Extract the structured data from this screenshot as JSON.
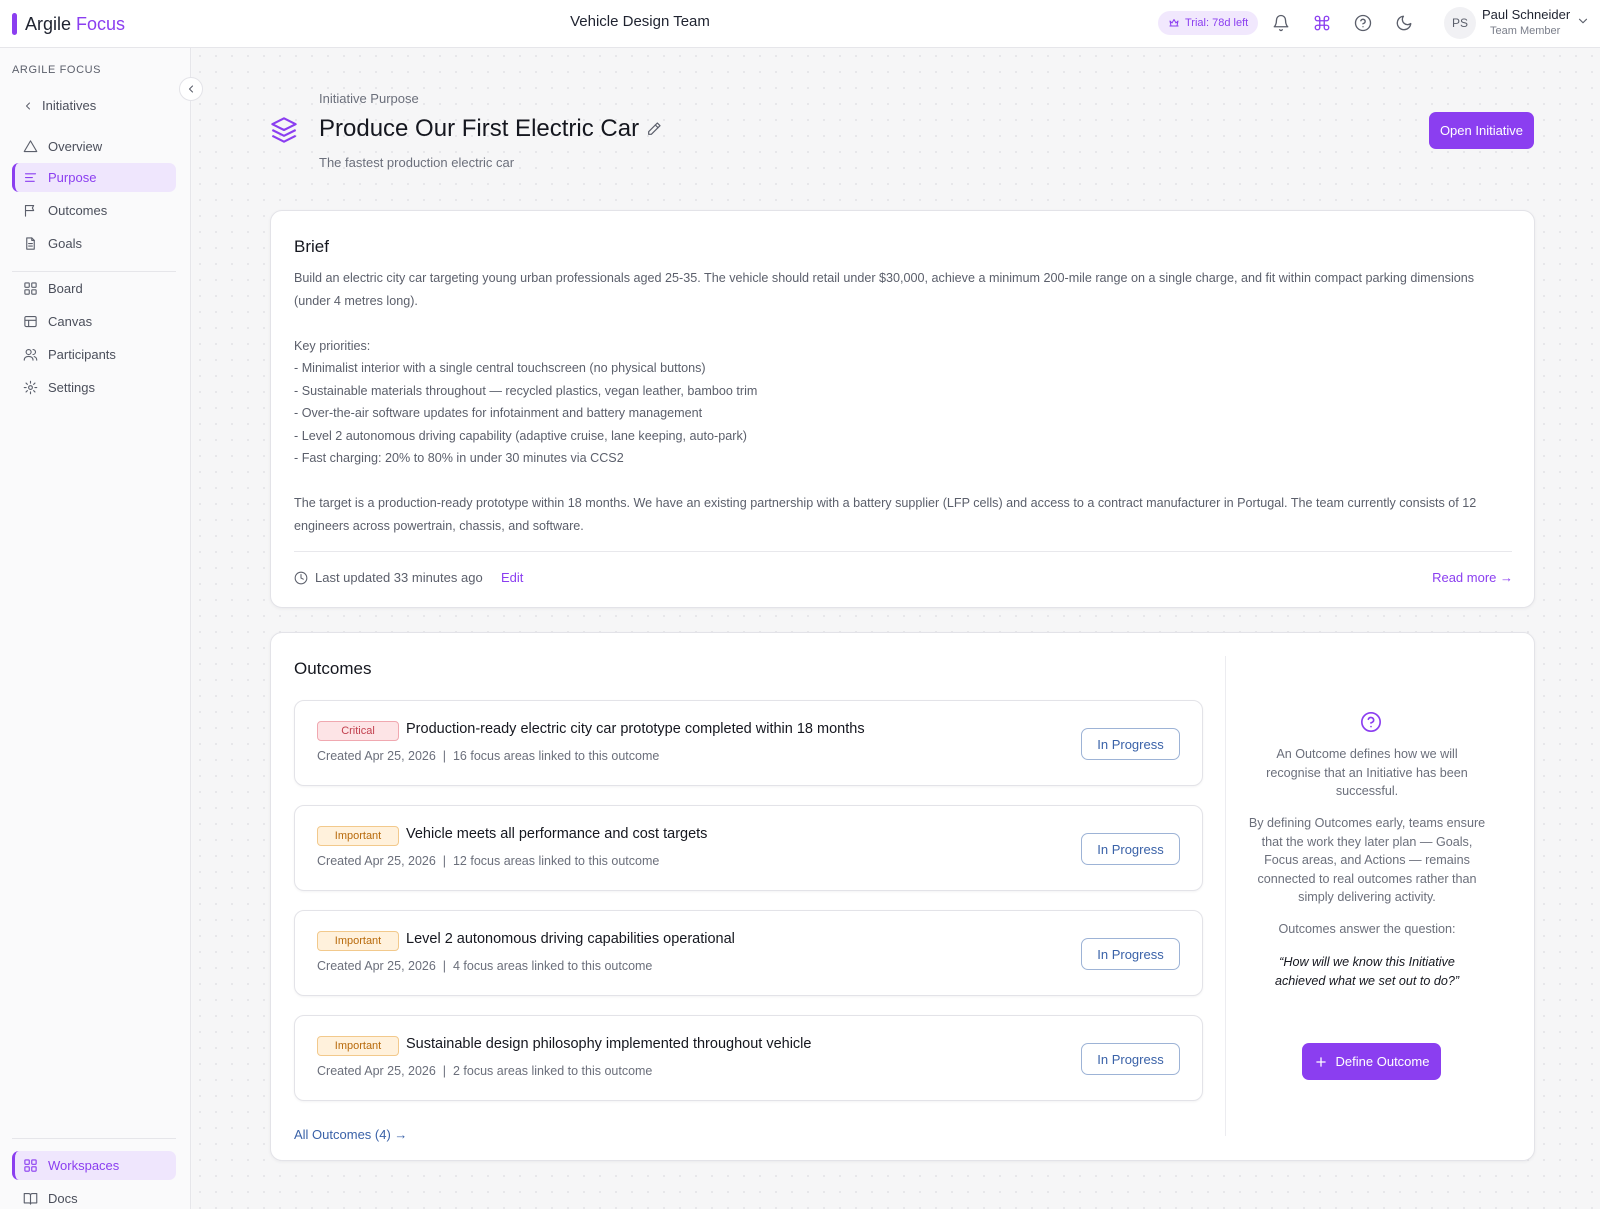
{
  "app": {
    "brand_name": "Argile",
    "brand_accent": "Focus",
    "team_title": "Vehicle Design Team",
    "trial_badge": "Trial: 78d left",
    "accent_color": "#8b3ef0"
  },
  "user": {
    "initials": "PS",
    "name": "Paul Schneider",
    "role": "Team Member"
  },
  "sidebar": {
    "heading": "ARGILE FOCUS",
    "back_label": "Initiatives",
    "items": [
      {
        "label": "Overview",
        "icon": "triangle-icon"
      },
      {
        "label": "Purpose",
        "icon": "align-left-icon",
        "active": true
      },
      {
        "label": "Outcomes",
        "icon": "flag-icon"
      },
      {
        "label": "Goals",
        "icon": "document-icon"
      },
      {
        "label": "Board",
        "icon": "grid-icon"
      },
      {
        "label": "Canvas",
        "icon": "layout-icon"
      },
      {
        "label": "Participants",
        "icon": "users-icon"
      },
      {
        "label": "Settings",
        "icon": "gear-icon"
      }
    ],
    "bottom": [
      {
        "label": "Workspaces",
        "icon": "grid-icon",
        "active": true
      },
      {
        "label": "Docs",
        "icon": "book-icon"
      }
    ]
  },
  "page": {
    "eyebrow": "Initiative Purpose",
    "title": "Produce Our First Electric Car",
    "subtitle": "The fastest production electric car",
    "open_button": "Open Initiative"
  },
  "brief": {
    "title": "Brief",
    "paragraph_1": "Build an electric city car targeting young urban professionals aged 25-35. The vehicle should retail under $30,000, achieve a minimum 200-mile range on a single charge, and fit within compact parking dimensions (under 4 metres long).",
    "priorities_heading": "Key priorities:",
    "priorities": [
      "- Minimalist interior with a single central touchscreen (no physical buttons)",
      "- Sustainable materials throughout — recycled plastics, vegan leather, bamboo trim",
      "- Over-the-air software updates for infotainment and battery management",
      "- Level 2 autonomous driving capability (adaptive cruise, lane keeping, auto-park)",
      "- Fast charging: 20% to 80% in under 30 minutes via CCS2"
    ],
    "paragraph_2": "The target is a production-ready prototype within 18 months. We have an existing partnership with a battery supplier (LFP cells) and access to a contract manufacturer in Portugal. The team currently consists of 12 engineers across powertrain, chassis, and software.",
    "last_updated": "Last updated 33 minutes ago",
    "edit_label": "Edit",
    "read_more": "Read more →"
  },
  "outcomes": {
    "title": "Outcomes",
    "items": [
      {
        "priority": "Critical",
        "title": "Production-ready electric city car prototype completed within 18 months",
        "meta": "Created Apr 25, 2026  |  16 focus areas linked to this outcome",
        "status": "In Progress"
      },
      {
        "priority": "Important",
        "title": "Vehicle meets all performance and cost targets",
        "meta": "Created Apr 25, 2026  |  12 focus areas linked to this outcome",
        "status": "In Progress"
      },
      {
        "priority": "Important",
        "title": "Level 2 autonomous driving capabilities operational",
        "meta": "Created Apr 25, 2026  |  4 focus areas linked to this outcome",
        "status": "In Progress"
      },
      {
        "priority": "Important",
        "title": "Sustainable design philosophy implemented throughout vehicle",
        "meta": "Created Apr 25, 2026  |  2 focus areas linked to this outcome",
        "status": "In Progress"
      }
    ],
    "all_link": "All Outcomes (4) →",
    "info": {
      "p1": "An Outcome defines how we will recognise that an Initiative has been successful.",
      "p2": "By defining Outcomes early, teams ensure that the work they later plan — Goals, Focus areas, and Actions — remains connected to real outcomes rather than simply delivering activity.",
      "p3": "Outcomes answer the question:",
      "quote": "“How will we know this Initiative achieved what we set out to do?”"
    },
    "define_button": "Define Outcome"
  }
}
